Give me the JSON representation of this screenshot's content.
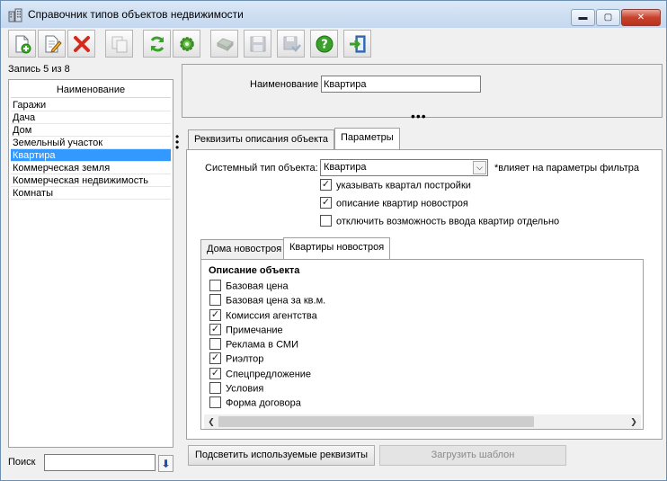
{
  "window": {
    "title": "Справочник типов объектов недвижимости",
    "controls": {
      "minimize": "▬",
      "maximize": "▢",
      "close": "✕"
    }
  },
  "toolbar": {
    "buttons": [
      {
        "icon": "add-document-icon",
        "enabled": true
      },
      {
        "icon": "edit-document-icon",
        "enabled": true
      },
      {
        "icon": "delete-icon",
        "enabled": true
      },
      {
        "icon": "copy-icon",
        "enabled": false
      },
      {
        "icon": "refresh-icon",
        "enabled": true
      },
      {
        "icon": "settings-gear-icon",
        "enabled": true
      },
      {
        "icon": "print-icon",
        "enabled": false
      },
      {
        "icon": "save-icon",
        "enabled": false
      },
      {
        "icon": "save-close-icon",
        "enabled": false
      },
      {
        "icon": "help-icon",
        "enabled": true
      },
      {
        "icon": "exit-icon",
        "enabled": true
      }
    ]
  },
  "left": {
    "record_status": "Запись 5 из 8",
    "list_header": "Наименование",
    "items": [
      "Гаражи",
      "Дача",
      "Дом",
      "Земельный участок",
      "Квартира",
      "Коммерческая земля",
      "Коммерческая недвижимость",
      "Комнаты"
    ],
    "selected_index": 4,
    "search_label": "Поиск",
    "search_value": "",
    "search_button": "⬇"
  },
  "details": {
    "name_label": "Наименование",
    "name_value": "Квартира",
    "splitter_h": "•••",
    "splitter_v": "•\n•\n•"
  },
  "tabs": [
    {
      "label": "Реквизиты описания объекта",
      "active": false
    },
    {
      "label": "Параметры",
      "active": true
    }
  ],
  "params": {
    "system_type_label": "Системный тип объекта:",
    "system_type_value": "Квартира",
    "dropdown_arrow": "⌵",
    "note": "*влияет на параметры фильтра",
    "options": [
      {
        "label": "указывать квартал постройки",
        "checked": true
      },
      {
        "label": "описание квартир новостроя",
        "checked": true
      },
      {
        "label": "отключить возможность ввода квартир отдельно",
        "checked": false
      }
    ],
    "inner_tabs": [
      {
        "label": "Дома новостроя",
        "active": false
      },
      {
        "label": "Квартиры новостроя",
        "active": true
      }
    ],
    "description_title": "Описание объекта",
    "fields": [
      {
        "label": "Базовая цена",
        "checked": false
      },
      {
        "label": "Базовая цена за кв.м.",
        "checked": false
      },
      {
        "label": "Комиссия агентства",
        "checked": true
      },
      {
        "label": "Примечание",
        "checked": true
      },
      {
        "label": "Реклама в СМИ",
        "checked": false
      },
      {
        "label": "Риэлтор",
        "checked": true
      },
      {
        "label": "Спецпредложение",
        "checked": true
      },
      {
        "label": "Условия",
        "checked": false
      },
      {
        "label": "Форма договора",
        "checked": false
      }
    ],
    "scroll_left": "❮",
    "scroll_right": "❯"
  },
  "buttons": {
    "highlight": "Подсветить используемые реквизиты",
    "load_template": "Загрузить шаблон"
  },
  "colors": {
    "selection": "#3399ff",
    "close_button": "#c8412c",
    "window_border": "#6d8fb1"
  }
}
